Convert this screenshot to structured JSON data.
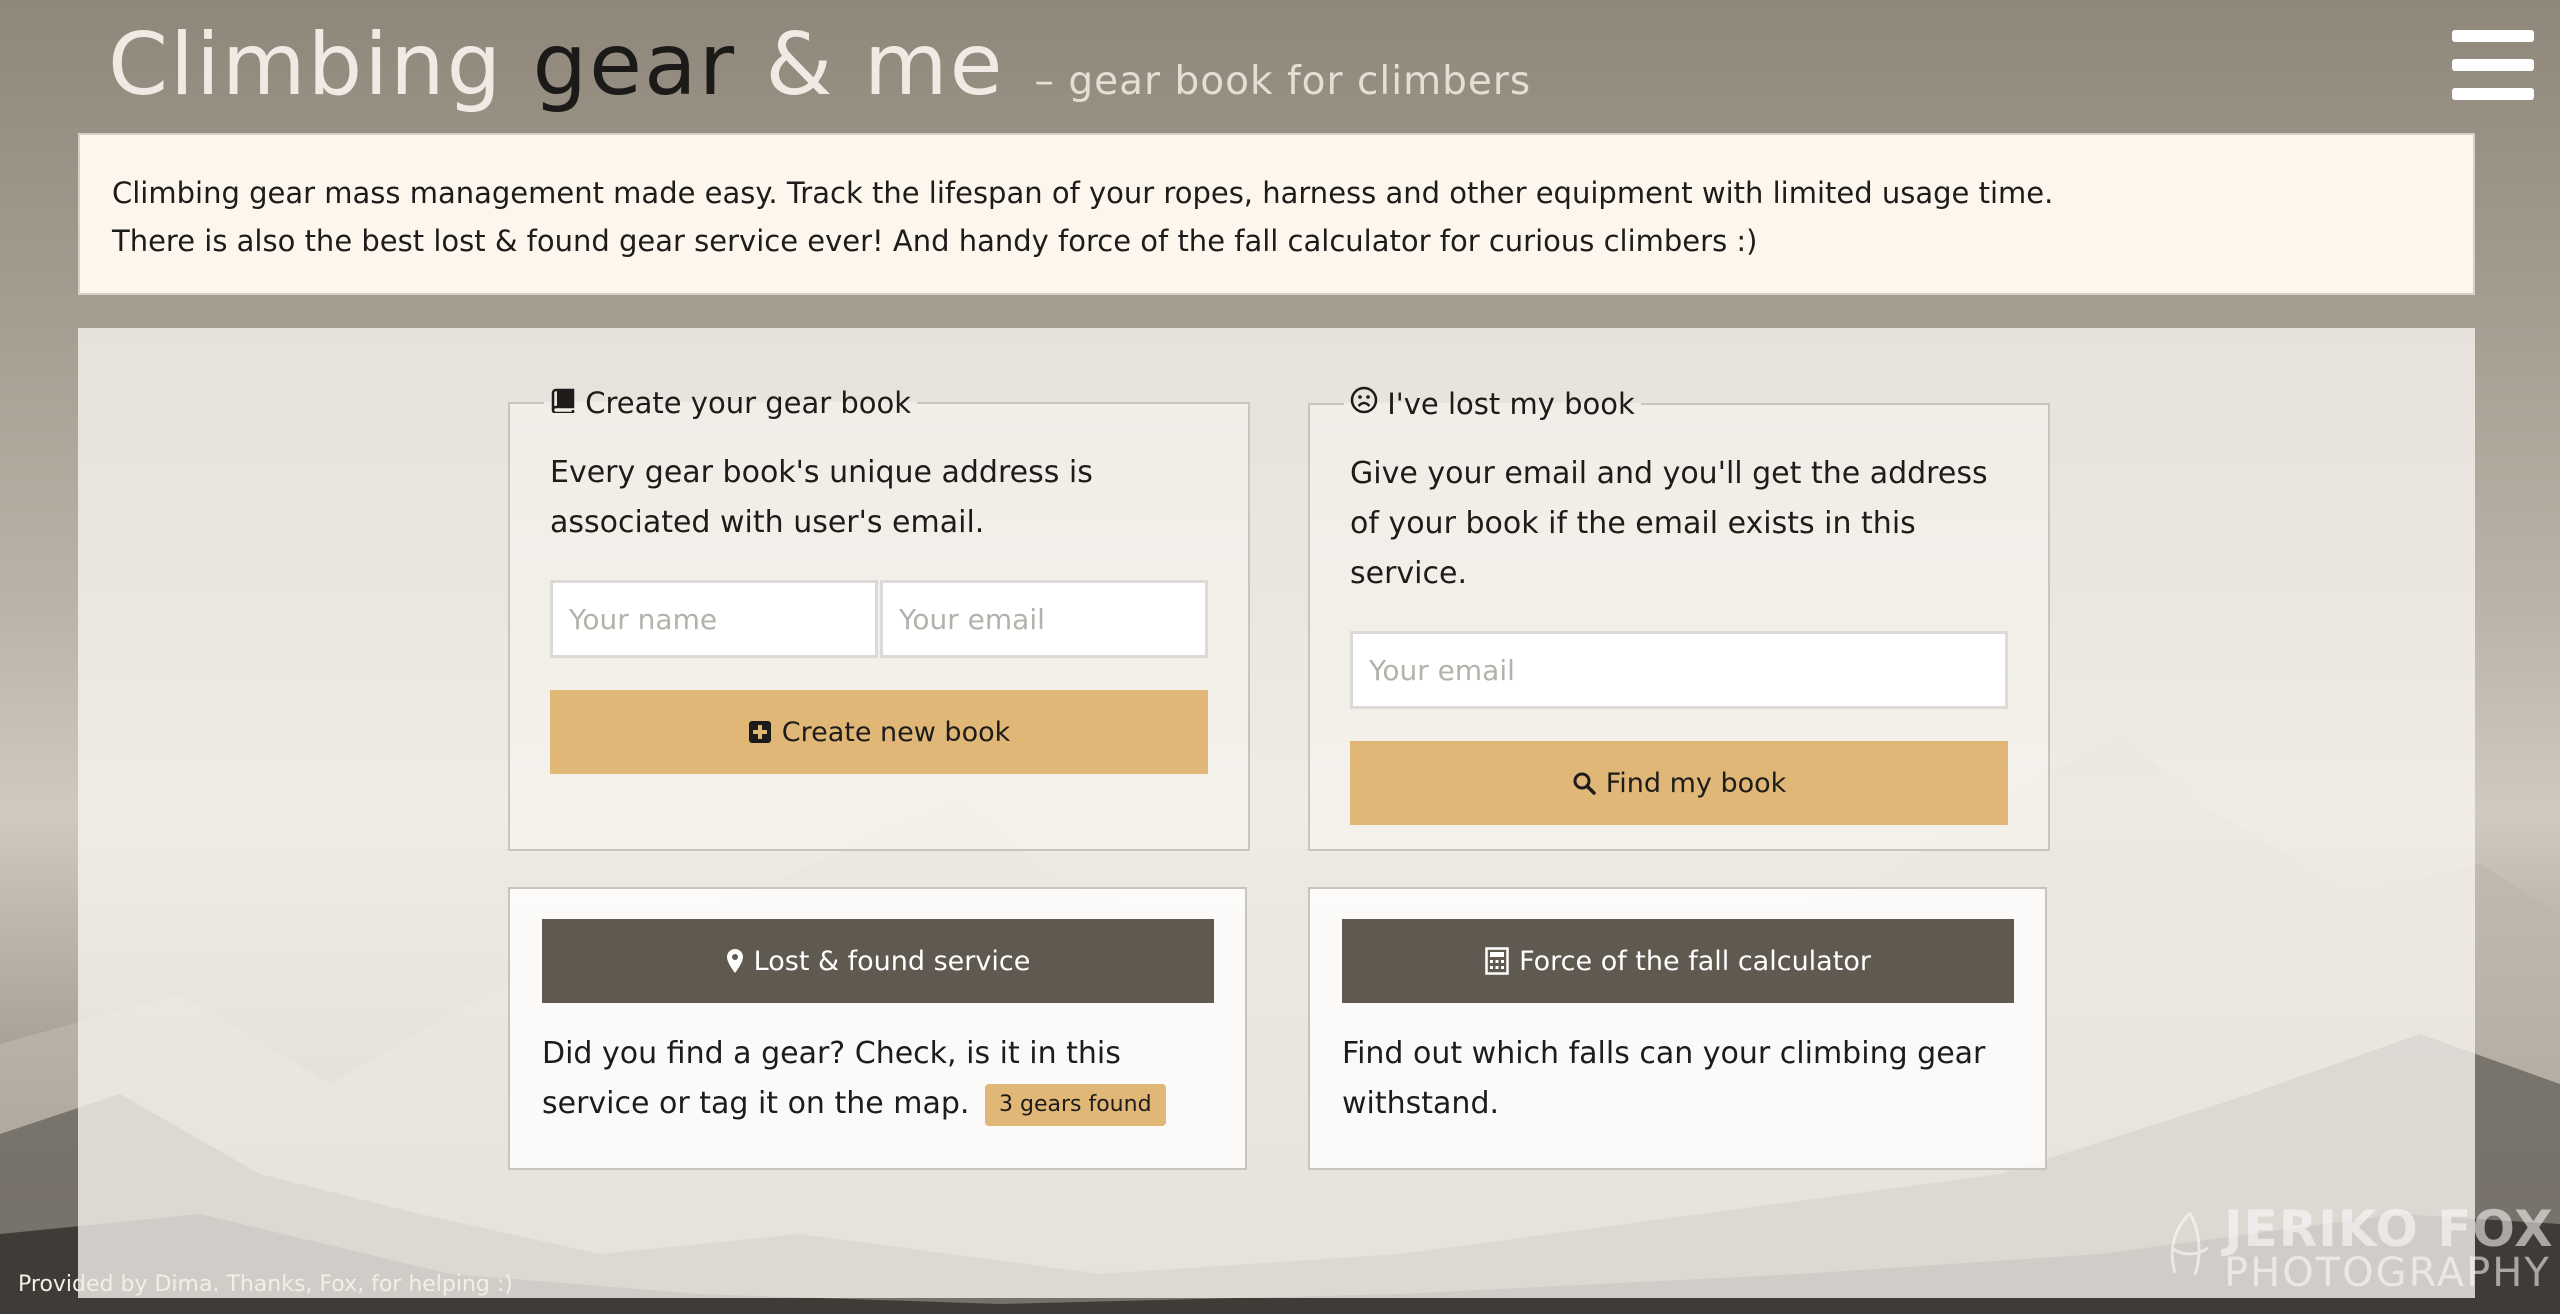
{
  "header": {
    "title_part1": "Climbing ",
    "title_part2": "gear",
    "title_part3": " & me",
    "subtitle": "– gear book for climbers",
    "menu_icon": "hamburger-menu-icon"
  },
  "intro": {
    "line1": "Climbing gear mass management made easy. Track the lifespan of your ropes, harness and other equipment with limited usage time.",
    "line2": "There is also the best lost & found gear service ever! And handy force of the fall calculator for curious climbers :)"
  },
  "create_book": {
    "legend": "Create your gear book",
    "legend_icon": "book-icon",
    "description": "Every gear book's unique address is associated with user's email.",
    "name_placeholder": "Your name",
    "email_placeholder": "Your email",
    "button_label": "Create new book",
    "button_icon": "plus-square-icon"
  },
  "lost_book": {
    "legend": "I've lost my book",
    "legend_icon": "frown-icon",
    "description": "Give your email and you'll get the address of your book if the email exists in this service.",
    "email_placeholder": "Your email",
    "button_label": "Find my book",
    "button_icon": "search-icon"
  },
  "lost_found": {
    "button_label": "Lost & found service",
    "button_icon": "map-marker-icon",
    "description": "Did you find a gear? Check, is it in this service or tag it on the map.",
    "badge": "3 gears found"
  },
  "force_calc": {
    "button_label": "Force of the fall calculator",
    "button_icon": "calculator-icon",
    "description": "Find out which falls can your climbing gear withstand."
  },
  "footer": {
    "credit": "Provided by Dima. Thanks, Fox, for helping :)"
  },
  "watermark": {
    "line1": "JERIKO FOX",
    "line2": "PHOTOGRAPHY"
  },
  "colors": {
    "accent": "#e1b777",
    "dark_button": "#5f594f",
    "intro_bg": "#fcf6ed"
  }
}
